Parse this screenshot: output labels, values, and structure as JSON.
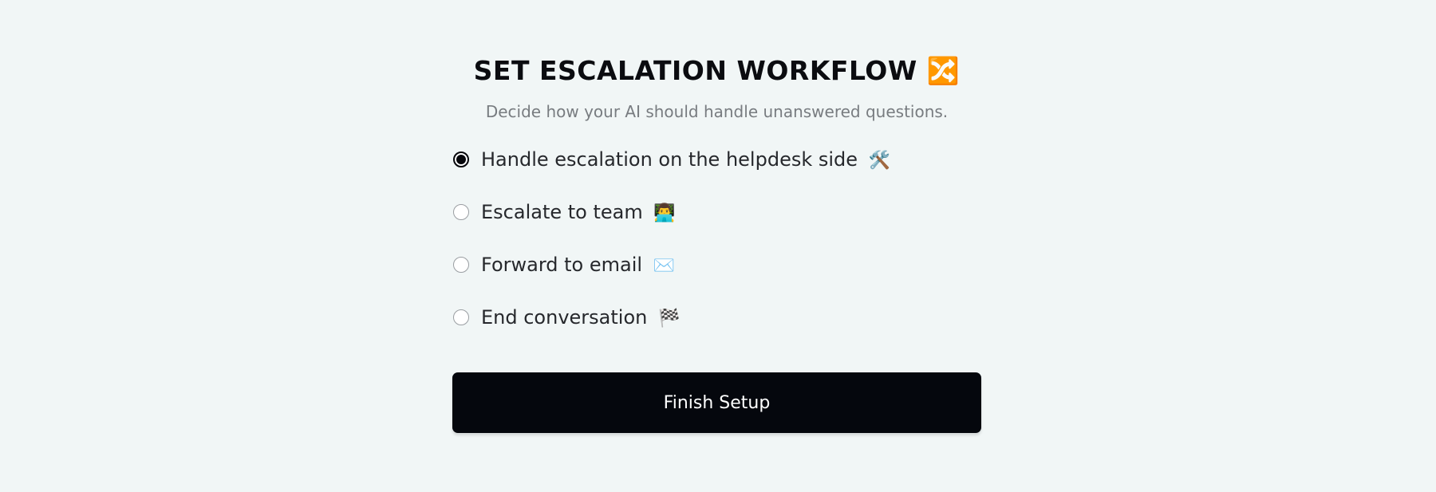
{
  "header": {
    "title": "SET ESCALATION WORKFLOW 🔀",
    "subtitle": "Decide how your AI should handle unanswered questions."
  },
  "options": [
    {
      "label": "Handle escalation on the helpdesk side",
      "emoji": "🛠️",
      "icon_name": "hammer-and-wrench-icon",
      "selected": true
    },
    {
      "label": "Escalate to team",
      "emoji": "👨‍💻",
      "icon_name": "technologist-icon",
      "selected": false
    },
    {
      "label": "Forward to email",
      "emoji": "✉️",
      "icon_name": "envelope-icon",
      "selected": false
    },
    {
      "label": "End conversation",
      "emoji": "🏁",
      "icon_name": "checkered-flag-icon",
      "selected": false
    }
  ],
  "footer": {
    "finish_label": "Finish Setup"
  },
  "colors": {
    "background": "#f1f6f6",
    "button": "#05070d",
    "title": "#0b0c10",
    "subtitle": "#787c80"
  }
}
